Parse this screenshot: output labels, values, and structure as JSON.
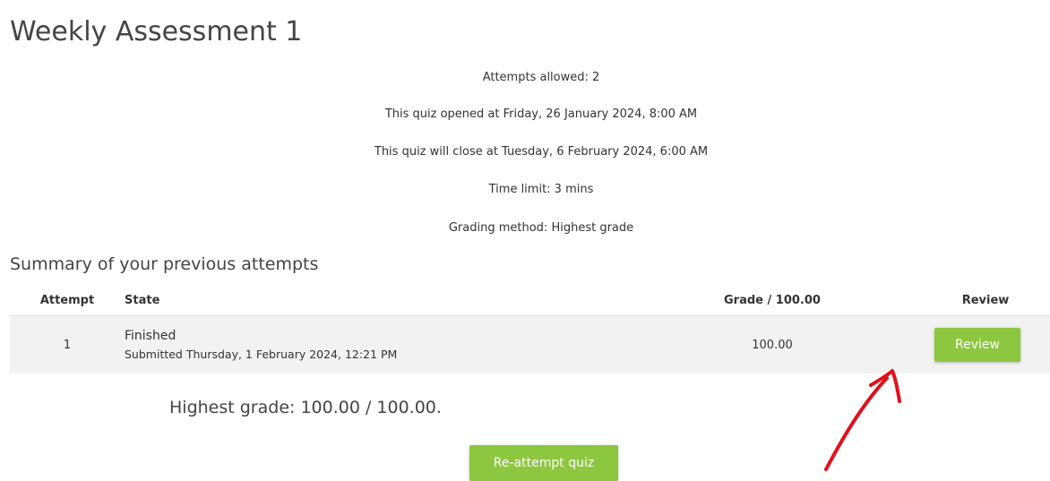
{
  "page": {
    "title": "Weekly Assessment 1"
  },
  "quiz_info": {
    "attempts_allowed": "Attempts allowed: 2",
    "opened": "This quiz opened at Friday, 26 January 2024, 8:00 AM",
    "closes": "This quiz will close at Tuesday, 6 February 2024, 6:00 AM",
    "time_limit": "Time limit: 3 mins",
    "grading_method": "Grading method: Highest grade"
  },
  "summary": {
    "heading": "Summary of your previous attempts",
    "columns": [
      "Attempt",
      "State",
      "Grade / 100.00",
      "Review"
    ],
    "rows": [
      {
        "attempt": "1",
        "state": "Finished",
        "submitted": "Submitted Thursday, 1 February 2024, 12:21 PM",
        "grade": "100.00",
        "review_label": "Review"
      }
    ]
  },
  "result": {
    "highest_grade": "Highest grade: 100.00 / 100.00."
  },
  "actions": {
    "reattempt_label": "Re-attempt quiz"
  },
  "colors": {
    "button_green": "#8dc63f",
    "annotation_red": "#e0101a",
    "row_background": "#f2f2f2"
  },
  "annotation": {
    "icon": "red-arrow-pointing-to-review-button"
  }
}
